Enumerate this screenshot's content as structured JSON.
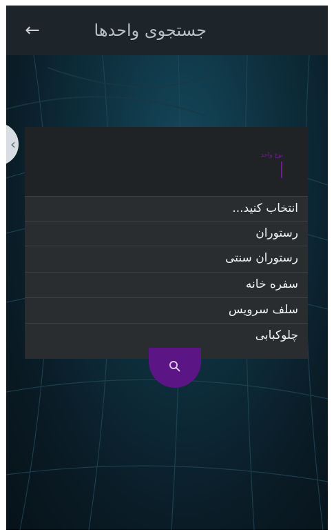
{
  "header": {
    "title": "جستجوی واحدها",
    "back_icon": "arrow-left-icon"
  },
  "side_tab": {
    "icon": "chevron-left-icon"
  },
  "field": {
    "label": "نوع واحد"
  },
  "dropdown": {
    "options": [
      "انتخاب کنید...",
      "رستوران",
      "رستوران سنتی",
      "سفره خانه",
      "سلف سرویس",
      "چلوکبابی"
    ]
  },
  "search_button": {
    "icon": "search-icon"
  },
  "colors": {
    "accent": "#5c1585",
    "appbar": "#1e252a",
    "dropdown_bg": "#2a2d30"
  }
}
